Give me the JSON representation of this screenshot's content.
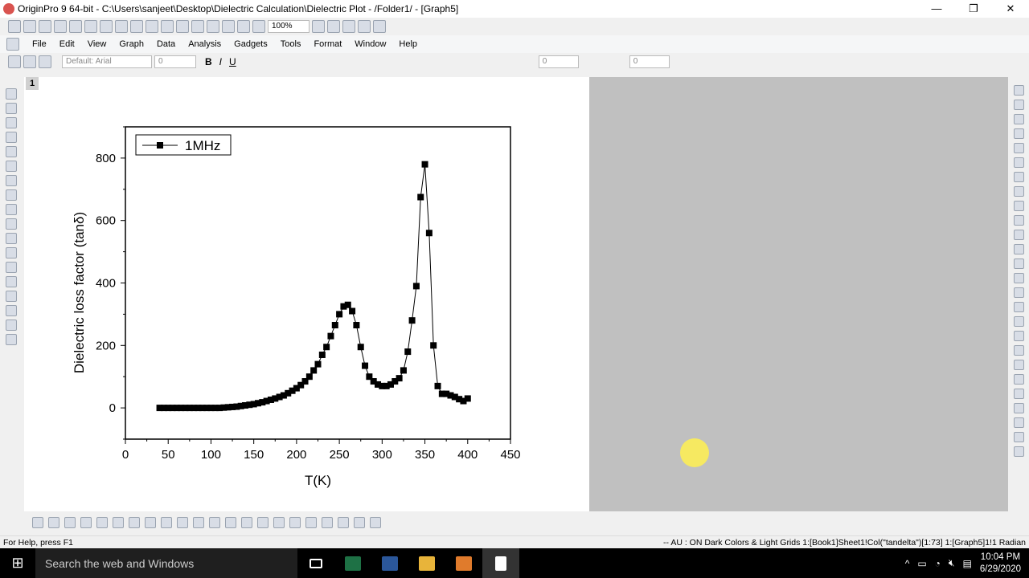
{
  "window": {
    "title": "OriginPro 9 64-bit - C:\\Users\\sanjeet\\Desktop\\Dielectric Calculation\\Dielectric Plot - /Folder1/ - [Graph5]",
    "minimize": "—",
    "restore": "❐",
    "close": "✕"
  },
  "toolbar": {
    "zoom": "100%"
  },
  "menu": [
    "File",
    "Edit",
    "View",
    "Graph",
    "Data",
    "Analysis",
    "Gadgets",
    "Tools",
    "Format",
    "Window",
    "Help"
  ],
  "format_toolbar": {
    "font": "Default: Arial",
    "size": "0",
    "line_width": "0",
    "border_width": "0"
  },
  "layer_tab": "1",
  "status": {
    "left": "For Help, press F1",
    "right": "-- AU : ON  Dark Colors & Light Grids  1:[Book1]Sheet1!Col(\"tandelta\")[1:73]  1:[Graph5]1!1  Radian"
  },
  "taskbar": {
    "search": "Search the web and Windows",
    "time": "10:04 PM",
    "date": "6/29/2020"
  },
  "chart_data": {
    "type": "line",
    "xlabel": "T(K)",
    "ylabel": "Dielectric loss factor (tanδ)",
    "xlim": [
      0,
      450
    ],
    "ylim": [
      -100,
      900
    ],
    "xticks": [
      0,
      50,
      100,
      150,
      200,
      250,
      300,
      350,
      400,
      450
    ],
    "yticks": [
      0,
      200,
      400,
      600,
      800
    ],
    "legend_position": "top-left",
    "series": [
      {
        "name": "1MHz",
        "marker": "square",
        "color": "#000000",
        "x": [
          40,
          45,
          50,
          55,
          60,
          65,
          70,
          75,
          80,
          85,
          90,
          95,
          100,
          105,
          110,
          115,
          120,
          125,
          130,
          135,
          140,
          145,
          150,
          155,
          160,
          165,
          170,
          175,
          180,
          185,
          190,
          195,
          200,
          205,
          210,
          215,
          220,
          225,
          230,
          235,
          240,
          245,
          250,
          255,
          260,
          265,
          270,
          275,
          280,
          285,
          290,
          295,
          300,
          305,
          310,
          315,
          320,
          325,
          330,
          335,
          340,
          345,
          350,
          355,
          360,
          365,
          370,
          375,
          380,
          385,
          390,
          395,
          400
        ],
        "y": [
          0,
          0,
          0,
          0,
          0,
          0,
          0,
          0,
          0,
          0,
          0,
          0,
          0,
          0,
          0,
          1,
          2,
          3,
          4,
          6,
          8,
          10,
          12,
          15,
          18,
          22,
          26,
          30,
          35,
          40,
          47,
          55,
          63,
          73,
          85,
          100,
          120,
          140,
          170,
          195,
          230,
          265,
          300,
          325,
          330,
          310,
          265,
          195,
          135,
          100,
          85,
          75,
          70,
          70,
          75,
          85,
          95,
          120,
          180,
          280,
          390,
          675,
          780,
          560,
          200,
          70,
          45,
          45,
          40,
          35,
          28,
          22,
          30
        ]
      }
    ]
  }
}
